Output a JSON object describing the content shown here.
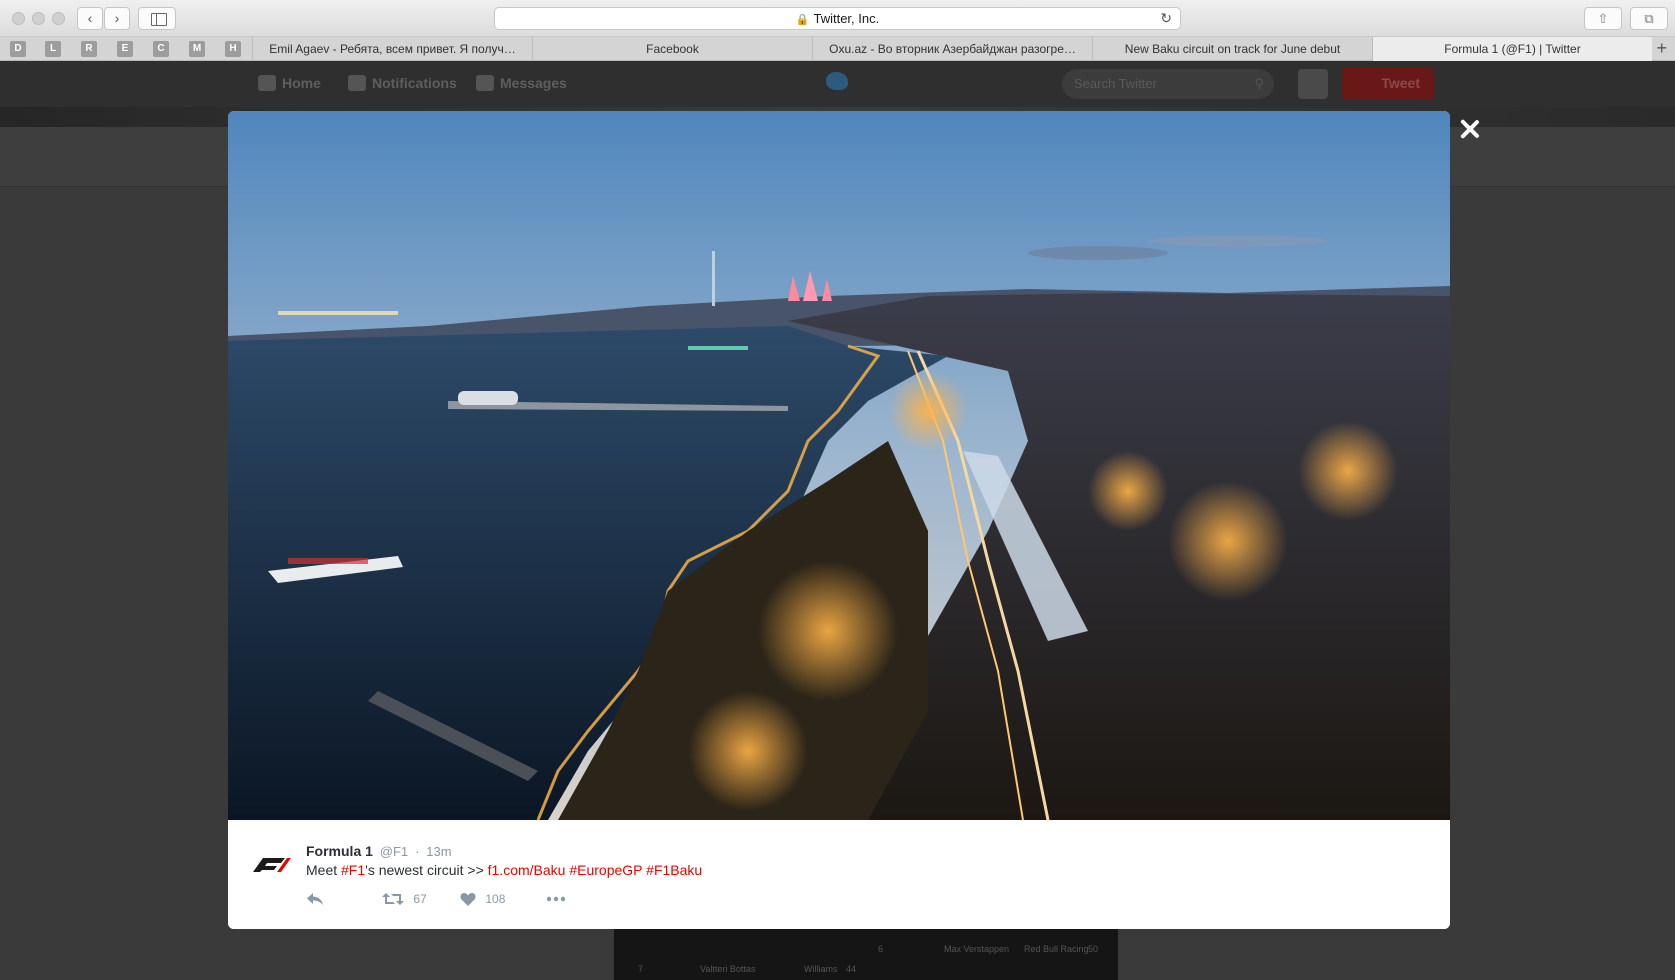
{
  "browser": {
    "address": "Twitter, Inc.",
    "bookmarks": [
      "D",
      "L",
      "R",
      "E",
      "C",
      "M",
      "H"
    ],
    "tabs": [
      {
        "title": "Emil Agaev - Ребята, всем привет. Я получ…"
      },
      {
        "title": "Facebook"
      },
      {
        "title": "Oxu.az - Во вторник Азербайджан разогре…"
      },
      {
        "title": "New Baku circuit on track for June debut"
      },
      {
        "title": "Formula 1 (@F1) | Twitter"
      }
    ],
    "new_tab": "+"
  },
  "twitter_nav": {
    "home": "Home",
    "notifications": "Notifications",
    "messages": "Messages",
    "search_placeholder": "Search Twitter",
    "tweet_button": "Tweet"
  },
  "background_card": {
    "row1_num": "6",
    "row1_name": "Max Verstappen",
    "row1_team": "Red Bull Racing",
    "row1_pts": "50",
    "row2_num": "7",
    "row2_name": "Valtteri Bottas",
    "row2_team": "Williams",
    "row2_pts": "44"
  },
  "tweet": {
    "author_name": "Formula 1",
    "author_handle": "@F1",
    "separator": "·",
    "time": "13m",
    "text_prefix": "Meet ",
    "hashtag_f1": "#F1",
    "text_middle": "'s newest circuit >> ",
    "link": "f1.com/Baku",
    "hashtag_europegp": "#EuropeGP",
    "hashtag_f1baku": "#F1Baku",
    "retweets": "67",
    "likes": "108"
  },
  "colors": {
    "accent": "#e10600",
    "muted": "#8899a6"
  }
}
